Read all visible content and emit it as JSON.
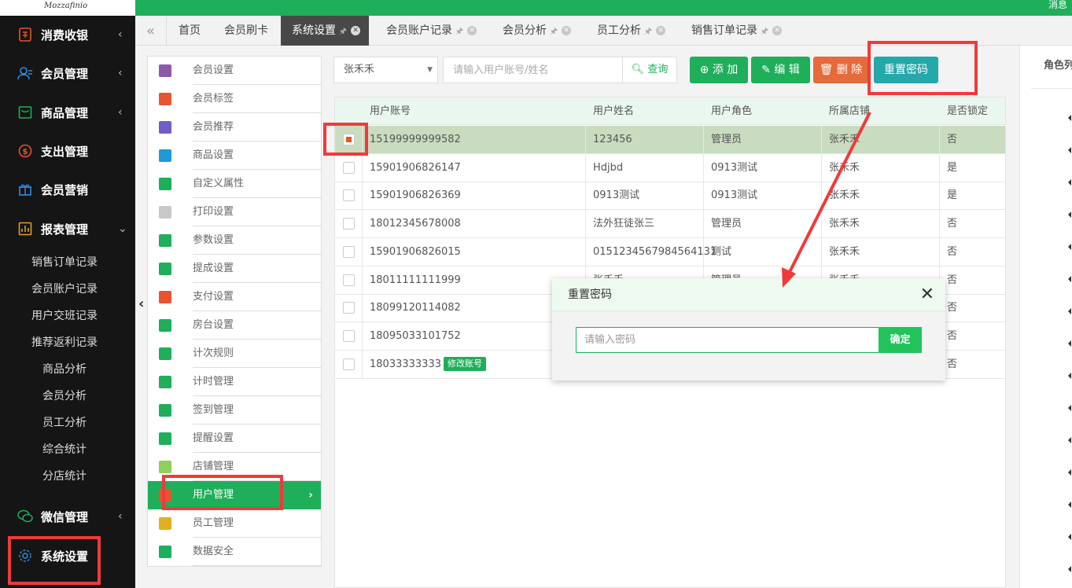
{
  "topbar": {
    "message": "消息"
  },
  "logo": {
    "text": "Mozzafinio"
  },
  "left_nav": {
    "top_items": [
      {
        "label": "消费收银",
        "icon": "cashier-icon"
      },
      {
        "label": "会员管理",
        "icon": "members-icon"
      },
      {
        "label": "商品管理",
        "icon": "goods-icon"
      },
      {
        "label": "支出管理",
        "icon": "expense-icon"
      },
      {
        "label": "会员营销",
        "icon": "gift-icon"
      },
      {
        "label": "报表管理",
        "icon": "report-icon"
      },
      {
        "label": "微信管理",
        "icon": "wechat-icon"
      },
      {
        "label": "系统设置",
        "icon": "gear-icon"
      }
    ],
    "report_subitems": [
      "销售订单记录",
      "会员账户记录",
      "用户交班记录",
      "推荐返利记录"
    ],
    "report_subsubitems": [
      "商品分析",
      "会员分析",
      "员工分析",
      "综合统计",
      "分店统计"
    ]
  },
  "tabs": [
    {
      "label": "首页"
    },
    {
      "label": "会员刷卡"
    },
    {
      "label": "系统设置"
    },
    {
      "label": "会员账户记录"
    },
    {
      "label": "会员分析"
    },
    {
      "label": "员工分析"
    },
    {
      "label": "销售订单记录"
    }
  ],
  "settings_menu": [
    {
      "label": "会员设置",
      "color": "#8e5aa8"
    },
    {
      "label": "会员标签",
      "color": "#e8542f"
    },
    {
      "label": "会员推荐",
      "color": "#6c5fc7"
    },
    {
      "label": "商品设置",
      "color": "#1e9bd7"
    },
    {
      "label": "自定义属性",
      "color": "#1fae5a"
    },
    {
      "label": "打印设置",
      "color": "#c8c8c8"
    },
    {
      "label": "参数设置",
      "color": "#1fae5a"
    },
    {
      "label": "提成设置",
      "color": "#1fae5a"
    },
    {
      "label": "支付设置",
      "color": "#e8542f"
    },
    {
      "label": "房台设置",
      "color": "#1fae5a"
    },
    {
      "label": "计次规则",
      "color": "#1fae5a"
    },
    {
      "label": "计时管理",
      "color": "#1fae5a"
    },
    {
      "label": "签到管理",
      "color": "#1fae5a"
    },
    {
      "label": "提醒设置",
      "color": "#1fae5a"
    },
    {
      "label": "店铺管理",
      "color": "#8fcf5b"
    },
    {
      "label": "用户管理",
      "color": "#e8542f"
    },
    {
      "label": "员工管理",
      "color": "#e0b020"
    },
    {
      "label": "数据安全",
      "color": "#1fae5a"
    }
  ],
  "toolbar": {
    "store_value": "张禾禾",
    "search_placeholder": "请输入用户账号/姓名",
    "search_label": "查询",
    "add_label": "添 加",
    "edit_label": "编 辑",
    "delete_label": "删 除",
    "reset_label": "重置密码"
  },
  "table": {
    "headers": [
      "用户账号",
      "用户姓名",
      "用户角色",
      "所属店铺",
      "是否锁定"
    ],
    "rows": [
      {
        "account": "15199999999582",
        "name": "123456",
        "role": "管理员",
        "store": "张禾禾",
        "locked": "否"
      },
      {
        "account": "15901906826147",
        "name": "Hdjbd",
        "role": "0913测试",
        "store": "张禾禾",
        "locked": "是"
      },
      {
        "account": "15901906826369",
        "name": "0913测试",
        "role": "0913测试",
        "store": "张禾禾",
        "locked": "是"
      },
      {
        "account": "18012345678008",
        "name": "法外狂徒张三",
        "role": "管理员",
        "store": "张禾禾",
        "locked": "否"
      },
      {
        "account": "15901906826015",
        "name": "0151234567984564131",
        "role": "测试",
        "store": "张禾禾",
        "locked": "否"
      },
      {
        "account": "18011111111999",
        "name": "张禾禾",
        "role": "管理员",
        "store": "张禾禾",
        "locked": "否"
      },
      {
        "account": "18099120114082",
        "name": "",
        "role": "",
        "store": "",
        "locked": "否"
      },
      {
        "account": "18095033101752",
        "name": "",
        "role": "",
        "store": "",
        "locked": "否"
      },
      {
        "account": "18033333333",
        "name": "",
        "role": "",
        "store": "",
        "locked": "否"
      }
    ],
    "edit_badge": "修改账号"
  },
  "right_panel": {
    "header": "角色列"
  },
  "modal": {
    "title": "重置密码",
    "placeholder": "请输入密码",
    "confirm_label": "确定"
  }
}
